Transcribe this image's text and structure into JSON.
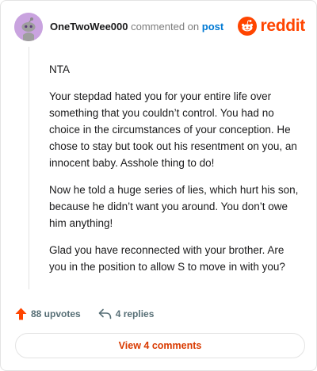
{
  "comment": {
    "username": "OneTwoWee000",
    "action": "commented on",
    "post_link": "post",
    "paragraphs": [
      "NTA",
      "Your stepdad hated you for your entire life over something that you couldn’t control. You had no choice in the circumstances of your conception. He chose to stay but took out his resentment on you, an innocent baby. Asshole thing to do!",
      "Now he told a huge series of lies, which hurt his son, because he didn’t want you around. You don’t owe him anything!",
      "Glad you have reconnected with your brother. Are you in the position to allow S to move in with you?"
    ]
  },
  "brand": {
    "name": "reddit",
    "icon": "reddit-logo-icon",
    "color": "#ff4500"
  },
  "footer": {
    "upvotes": "88 upvotes",
    "replies": "4 replies",
    "upvote_icon": "upvote-arrow-icon",
    "reply_icon": "reply-arrow-icon",
    "upvote_color": "#ff4500"
  },
  "view_button": {
    "label": "View 4 comments"
  }
}
